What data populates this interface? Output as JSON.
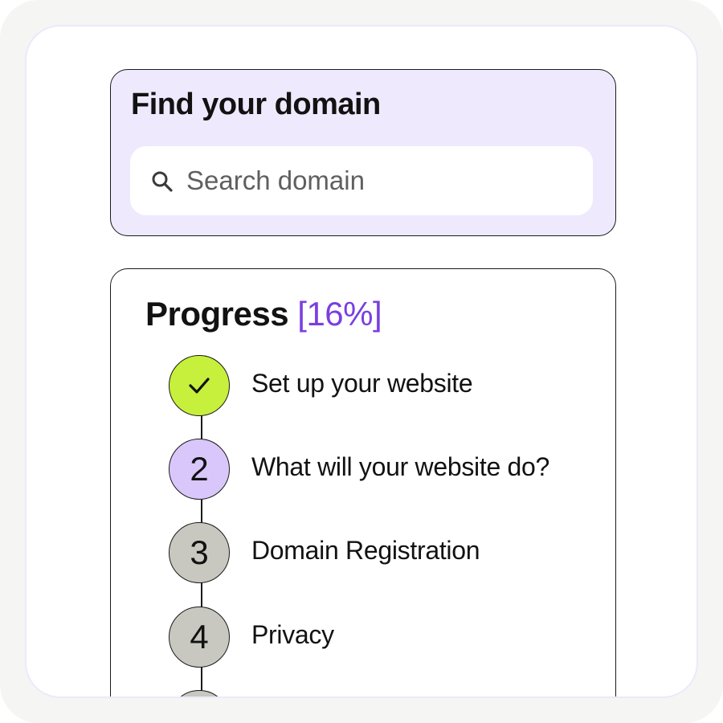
{
  "domain_search": {
    "title": "Find your domain",
    "placeholder": "Search domain",
    "value": ""
  },
  "progress": {
    "label": "Progress",
    "percent": "16%",
    "open_bracket": "[",
    "close_bracket": "]"
  },
  "steps": [
    {
      "number": "",
      "label": "Set up your website",
      "state": "complete",
      "icon": "check-icon"
    },
    {
      "number": "2",
      "label": "What will your website do?",
      "state": "current"
    },
    {
      "number": "3",
      "label": "Domain Registration",
      "state": "pending"
    },
    {
      "number": "4",
      "label": "Privacy",
      "state": "pending"
    },
    {
      "number": "",
      "label": "",
      "state": "pending"
    }
  ],
  "colors": {
    "frame": "#f5f5f3",
    "card_lavender": "#efe9fd",
    "accent_purple": "#7a3fe0",
    "step_complete": "#c6f03c",
    "step_current": "#d9c7fb",
    "step_pending": "#c8c8c0",
    "ink": "#121212"
  }
}
